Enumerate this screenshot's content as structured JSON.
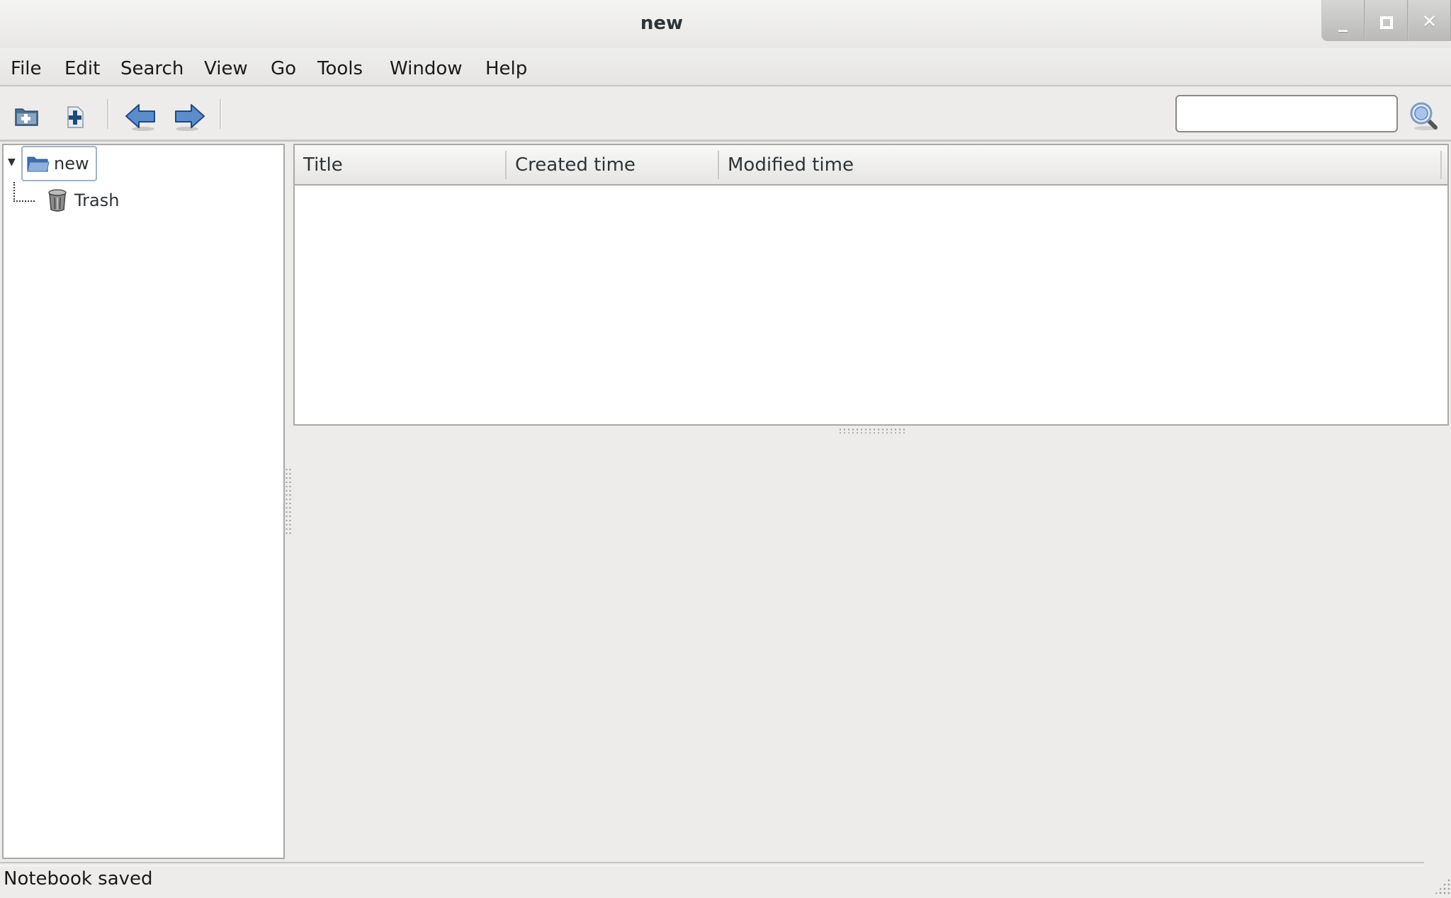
{
  "window": {
    "title": "new",
    "controls": {
      "minimize": "_",
      "maximize": "□",
      "close": "✕"
    }
  },
  "menubar": {
    "items": [
      "File",
      "Edit",
      "Search",
      "View",
      "Go",
      "Tools",
      "Window",
      "Help"
    ]
  },
  "toolbar": {
    "buttons": [
      {
        "name": "new-notebook",
        "icon": "new-folder-icon"
      },
      {
        "name": "new-page",
        "icon": "new-page-icon"
      },
      {
        "name": "back",
        "icon": "arrow-left-icon"
      },
      {
        "name": "forward",
        "icon": "arrow-right-icon"
      }
    ],
    "search": {
      "value": "",
      "placeholder": "",
      "icon": "magnifier-icon"
    }
  },
  "tree": {
    "nodes": [
      {
        "label": "new",
        "icon": "open-folder-icon",
        "expanded": true,
        "selected": true
      },
      {
        "label": "Trash",
        "icon": "trash-icon",
        "depth": 1
      }
    ]
  },
  "note_list": {
    "columns": [
      "Title",
      "Created time",
      "Modified time"
    ],
    "rows": []
  },
  "status": {
    "text": "Notebook saved"
  },
  "colors": {
    "accent_blue": "#3f6fb0",
    "selection_border": "#9fb2c8"
  }
}
